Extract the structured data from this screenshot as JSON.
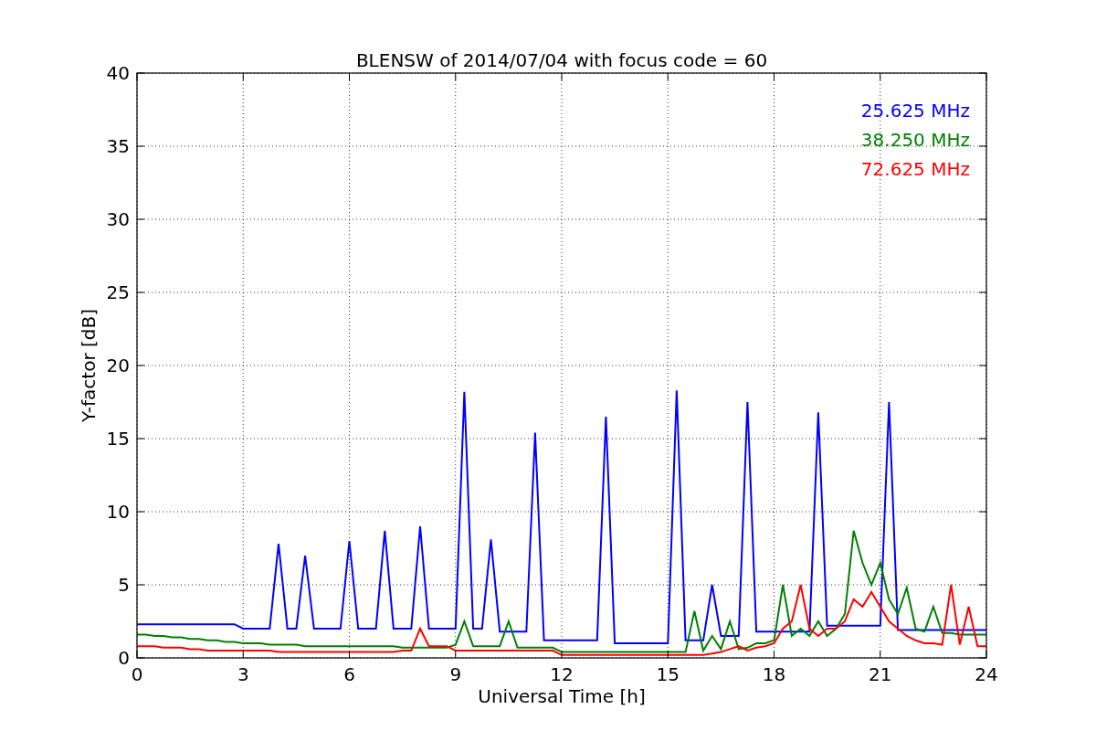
{
  "chart_data": {
    "type": "line",
    "title": "BLENSW of 2014/07/04 with focus code = 60",
    "xlabel": "Universal Time [h]",
    "ylabel": "Y-factor [dB]",
    "x": [
      0,
      0.25,
      0.5,
      0.75,
      1,
      1.25,
      1.5,
      1.75,
      2,
      2.25,
      2.5,
      2.75,
      3,
      3.25,
      3.5,
      3.75,
      4,
      4.25,
      4.5,
      4.75,
      5,
      5.25,
      5.5,
      5.75,
      6,
      6.25,
      6.5,
      6.75,
      7,
      7.25,
      7.5,
      7.75,
      8,
      8.25,
      8.5,
      8.75,
      9,
      9.25,
      9.5,
      9.75,
      10,
      10.25,
      10.5,
      10.75,
      11,
      11.25,
      11.5,
      11.75,
      12,
      12.25,
      12.5,
      12.75,
      13,
      13.25,
      13.5,
      13.75,
      14,
      14.25,
      14.5,
      14.75,
      15,
      15.25,
      15.5,
      15.75,
      16,
      16.25,
      16.5,
      16.75,
      17,
      17.25,
      17.5,
      17.75,
      18,
      18.25,
      18.5,
      18.75,
      19,
      19.25,
      19.5,
      19.75,
      20,
      20.25,
      20.5,
      20.75,
      21,
      21.25,
      21.5,
      21.75,
      22,
      22.25,
      22.5,
      22.75,
      23,
      23.25,
      23.5,
      23.75,
      24
    ],
    "series": [
      {
        "name": "25.625 MHz",
        "color": "#0000ff",
        "values": [
          2.3,
          2.3,
          2.3,
          2.3,
          2.3,
          2.3,
          2.3,
          2.3,
          2.3,
          2.3,
          2.3,
          2.3,
          2.0,
          2.0,
          2.0,
          2.0,
          7.8,
          2.0,
          2.0,
          7.0,
          2.0,
          2.0,
          2.0,
          2.0,
          8.0,
          2.0,
          2.0,
          2.0,
          8.7,
          2.0,
          2.0,
          2.0,
          9.0,
          2.0,
          2.0,
          2.0,
          2.0,
          18.2,
          2.0,
          2.0,
          8.1,
          1.8,
          1.8,
          1.8,
          1.8,
          15.4,
          1.2,
          1.2,
          1.2,
          1.2,
          1.2,
          1.2,
          1.2,
          16.5,
          1.0,
          1.0,
          1.0,
          1.0,
          1.0,
          1.0,
          1.0,
          18.3,
          1.2,
          1.2,
          1.2,
          5.0,
          1.5,
          1.5,
          1.5,
          17.5,
          1.8,
          1.8,
          1.8,
          1.8,
          1.8,
          1.8,
          1.8,
          16.8,
          2.2,
          2.2,
          2.2,
          2.2,
          2.2,
          2.2,
          2.2,
          17.5,
          1.9,
          1.9,
          1.9,
          1.9,
          1.9,
          1.9,
          1.9,
          1.9,
          1.9,
          1.9,
          1.9
        ]
      },
      {
        "name": "38.250 MHz",
        "color": "#008000",
        "values": [
          1.6,
          1.6,
          1.5,
          1.5,
          1.4,
          1.4,
          1.3,
          1.3,
          1.2,
          1.2,
          1.1,
          1.1,
          1.0,
          1.0,
          1.0,
          0.9,
          0.9,
          0.9,
          0.9,
          0.8,
          0.8,
          0.8,
          0.8,
          0.8,
          0.8,
          0.8,
          0.8,
          0.8,
          0.8,
          0.8,
          0.7,
          0.7,
          0.7,
          0.7,
          0.7,
          0.7,
          0.9,
          2.5,
          0.8,
          0.8,
          0.8,
          0.8,
          2.5,
          0.7,
          0.7,
          0.7,
          0.7,
          0.7,
          0.4,
          0.4,
          0.4,
          0.4,
          0.4,
          0.4,
          0.4,
          0.4,
          0.4,
          0.4,
          0.4,
          0.4,
          0.4,
          0.4,
          0.4,
          3.2,
          0.5,
          1.5,
          0.6,
          2.5,
          0.6,
          0.7,
          1.0,
          1.0,
          1.2,
          5.0,
          1.5,
          2.0,
          1.5,
          2.5,
          1.5,
          2.0,
          3.0,
          8.7,
          6.5,
          5.0,
          6.5,
          4.0,
          3.0,
          4.8,
          2.0,
          1.8,
          3.5,
          1.7,
          1.7,
          1.6,
          1.6,
          1.6,
          1.6
        ]
      },
      {
        "name": "72.625 MHz",
        "color": "#ff0000",
        "values": [
          0.8,
          0.8,
          0.8,
          0.7,
          0.7,
          0.7,
          0.6,
          0.6,
          0.5,
          0.5,
          0.5,
          0.5,
          0.5,
          0.5,
          0.5,
          0.5,
          0.4,
          0.4,
          0.4,
          0.4,
          0.4,
          0.4,
          0.4,
          0.4,
          0.4,
          0.4,
          0.4,
          0.4,
          0.4,
          0.4,
          0.5,
          0.5,
          2.0,
          0.8,
          0.8,
          0.8,
          0.5,
          0.5,
          0.5,
          0.5,
          0.5,
          0.5,
          0.5,
          0.5,
          0.5,
          0.5,
          0.5,
          0.5,
          0.2,
          0.2,
          0.2,
          0.2,
          0.2,
          0.2,
          0.2,
          0.2,
          0.2,
          0.2,
          0.2,
          0.2,
          0.2,
          0.2,
          0.2,
          0.2,
          0.2,
          0.3,
          0.4,
          0.6,
          0.8,
          0.5,
          0.7,
          0.8,
          1.0,
          2.0,
          2.5,
          5.0,
          2.0,
          1.5,
          2.0,
          2.0,
          2.5,
          4.0,
          3.5,
          4.5,
          3.5,
          2.5,
          2.0,
          1.5,
          1.2,
          1.0,
          1.0,
          0.9,
          5.0,
          0.9,
          3.5,
          0.8,
          0.8
        ]
      }
    ],
    "xlim": [
      0,
      24
    ],
    "ylim": [
      0,
      40
    ],
    "xticks": [
      0,
      3,
      6,
      9,
      12,
      15,
      18,
      21,
      24
    ],
    "yticks": [
      0,
      5,
      10,
      15,
      20,
      25,
      30,
      35,
      40
    ],
    "grid": true
  }
}
